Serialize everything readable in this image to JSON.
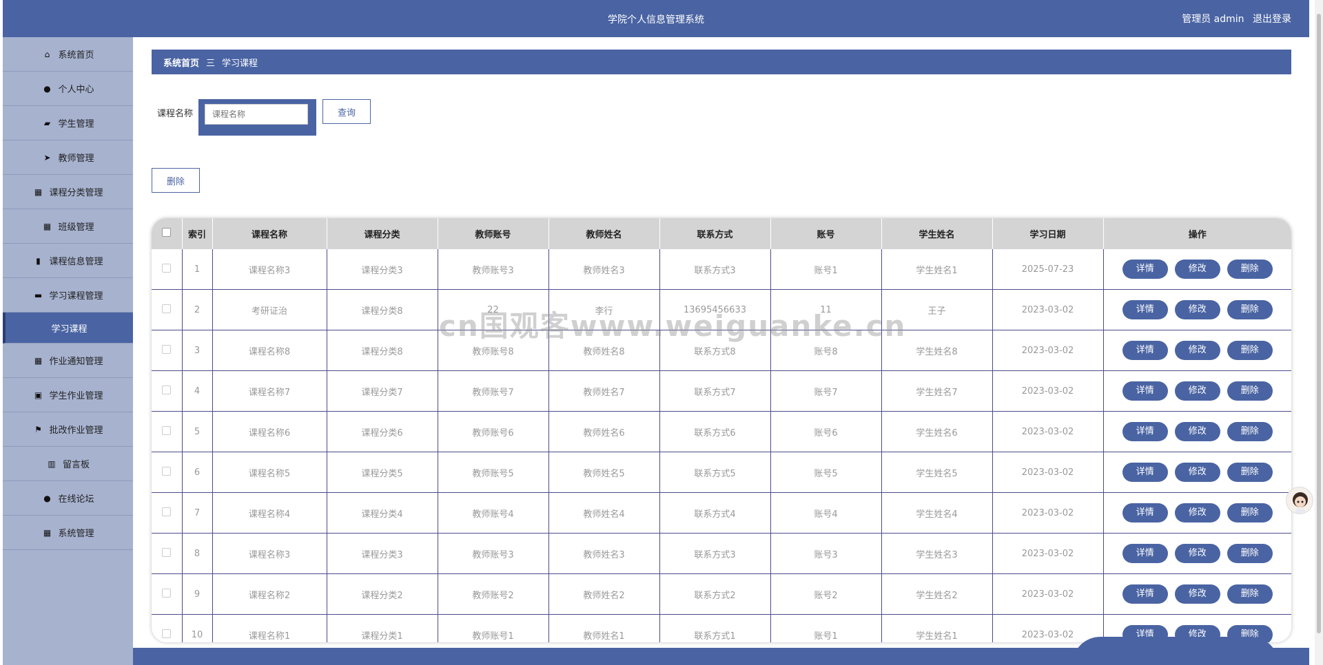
{
  "header": {
    "title": "学院个人信息管理系统",
    "user_label": "管理员 admin",
    "logout": "退出登录"
  },
  "sidebar": {
    "items": [
      {
        "label": "系统首页",
        "icon": "home-icon",
        "glyph": "⌂"
      },
      {
        "label": "个人中心",
        "icon": "user-icon",
        "glyph": "●"
      },
      {
        "label": "学生管理",
        "icon": "briefcase-icon",
        "glyph": "▰"
      },
      {
        "label": "教师管理",
        "icon": "paper-plane-icon",
        "glyph": "➤"
      },
      {
        "label": "课程分类管理",
        "icon": "grid-icon",
        "glyph": "▦"
      },
      {
        "label": "班级管理",
        "icon": "grid-icon",
        "glyph": "▦"
      },
      {
        "label": "课程信息管理",
        "icon": "bar-chart-icon",
        "glyph": "▮"
      },
      {
        "label": "学习课程管理",
        "icon": "inbox-icon",
        "glyph": "▬"
      },
      {
        "label": "学习课程",
        "icon": "",
        "glyph": "",
        "active": true
      },
      {
        "label": "作业通知管理",
        "icon": "grid-icon",
        "glyph": "▦"
      },
      {
        "label": "学生作业管理",
        "icon": "clipboard-icon",
        "glyph": "▣"
      },
      {
        "label": "批改作业管理",
        "icon": "flag-icon",
        "glyph": "⚑"
      },
      {
        "label": "留言板",
        "icon": "book-icon",
        "glyph": "▥"
      },
      {
        "label": "在线论坛",
        "icon": "user-icon",
        "glyph": "●"
      },
      {
        "label": "系统管理",
        "icon": "grid-icon",
        "glyph": "▦"
      }
    ]
  },
  "breadcrumb": {
    "home": "系统首页",
    "separator": "三",
    "current": "学习课程"
  },
  "search": {
    "label": "课程名称",
    "placeholder": "课程名称",
    "value": "",
    "button": "查询"
  },
  "actions": {
    "delete": "删除"
  },
  "table": {
    "columns": [
      "",
      "索引",
      "课程名称",
      "课程分类",
      "教师账号",
      "教师姓名",
      "联系方式",
      "账号",
      "学生姓名",
      "学习日期",
      "操作"
    ],
    "row_buttons": [
      "详情",
      "修改",
      "删除"
    ],
    "rows": [
      [
        "1",
        "课程名称3",
        "课程分类3",
        "教师账号3",
        "教师姓名3",
        "联系方式3",
        "账号1",
        "学生姓名1",
        "2025-07-23"
      ],
      [
        "2",
        "考研证治",
        "课程分类8",
        "22",
        "李行",
        "13695456633",
        "11",
        "王子",
        "2023-03-02"
      ],
      [
        "3",
        "课程名称8",
        "课程分类8",
        "教师账号8",
        "教师姓名8",
        "联系方式8",
        "账号8",
        "学生姓名8",
        "2023-03-02"
      ],
      [
        "4",
        "课程名称7",
        "课程分类7",
        "教师账号7",
        "教师姓名7",
        "联系方式7",
        "账号7",
        "学生姓名7",
        "2023-03-02"
      ],
      [
        "5",
        "课程名称6",
        "课程分类6",
        "教师账号6",
        "教师姓名6",
        "联系方式6",
        "账号6",
        "学生姓名6",
        "2023-03-02"
      ],
      [
        "6",
        "课程名称5",
        "课程分类5",
        "教师账号5",
        "教师姓名5",
        "联系方式5",
        "账号5",
        "学生姓名5",
        "2023-03-02"
      ],
      [
        "7",
        "课程名称4",
        "课程分类4",
        "教师账号4",
        "教师姓名4",
        "联系方式4",
        "账号4",
        "学生姓名4",
        "2023-03-02"
      ],
      [
        "8",
        "课程名称3",
        "课程分类3",
        "教师账号3",
        "教师姓名3",
        "联系方式3",
        "账号3",
        "学生姓名3",
        "2023-03-02"
      ],
      [
        "9",
        "课程名称2",
        "课程分类2",
        "教师账号2",
        "教师姓名2",
        "联系方式2",
        "账号2",
        "学生姓名2",
        "2023-03-02"
      ],
      [
        "10",
        "课程名称1",
        "课程分类1",
        "教师账号1",
        "教师姓名1",
        "联系方式1",
        "账号1",
        "学生姓名1",
        "2023-03-02"
      ]
    ]
  },
  "watermark": "cn国观客www.weiguanke.cn",
  "colors": {
    "primary": "#4a64a3",
    "sidebar_bg": "#a7b2cf",
    "header_cell": "#d4d4d4"
  }
}
